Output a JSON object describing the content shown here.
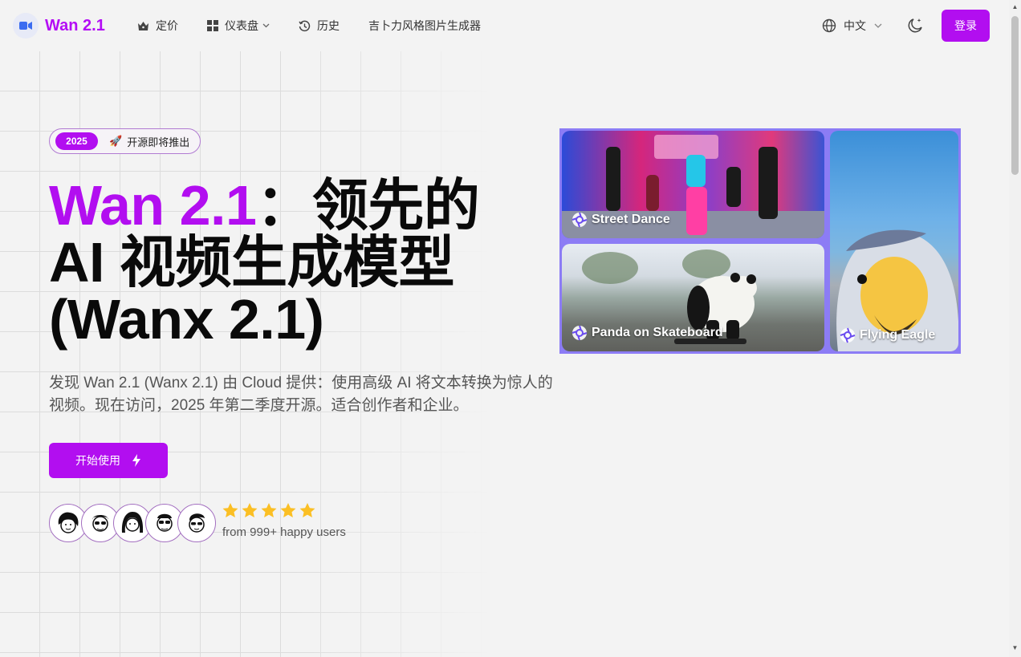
{
  "header": {
    "brand": "Wan 2.1",
    "nav": [
      {
        "label": "定价",
        "icon": "crown-icon"
      },
      {
        "label": "仪表盘",
        "icon": "dashboard-icon",
        "has_dropdown": true
      },
      {
        "label": "历史",
        "icon": "history-icon"
      },
      {
        "label": "吉卜力风格图片生成器"
      }
    ],
    "language": "中文",
    "login_label": "登录"
  },
  "hero": {
    "badge_year": "2025",
    "badge_text": "开源即将推出",
    "title_accent": "Wan 2.1",
    "title_rest": "：领先的 AI 视频生成模型 (Wanx 2.1)",
    "description": "发现 Wan 2.1 (Wanx 2.1) 由 Cloud 提供：使用高级 AI 将文本转换为惊人的视频。现在访问，2025 年第二季度开源。适合创作者和企业。",
    "cta_label": "开始使用",
    "rating_stars": 5,
    "users_text": "from 999+ happy users"
  },
  "media": {
    "tiles": [
      {
        "label": "Street Dance"
      },
      {
        "label": "Panda on Skateboard"
      },
      {
        "label": "Flying Eagle"
      }
    ]
  },
  "colors": {
    "accent": "#b20ef0",
    "background": "#f3f3f3",
    "media_frame": "#8c7cf5"
  }
}
